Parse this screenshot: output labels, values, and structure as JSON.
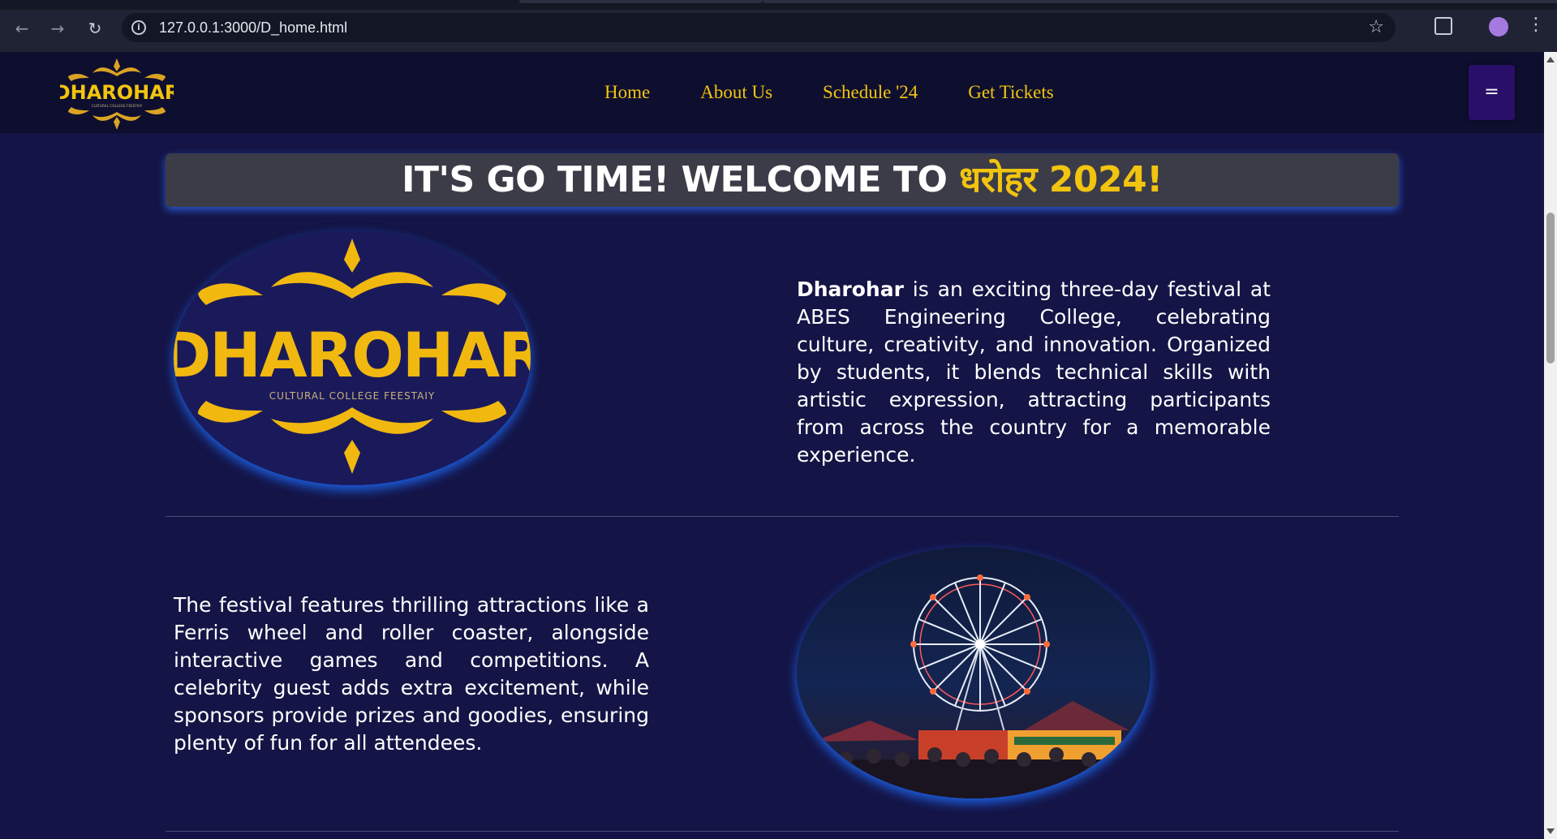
{
  "browser": {
    "url": "127.0.0.1:3000/D_home.html",
    "back_icon": "arrow-left-icon",
    "forward_icon": "arrow-right-icon",
    "reload_icon": "reload-icon",
    "info_icon": "site-info-icon",
    "bookmark_icon": "star-icon",
    "extensions_icon": "puzzle-icon",
    "menu_icon": "vertical-dots-icon"
  },
  "header": {
    "logo_text": "DHAROHAR",
    "logo_subtext": "CULTURAL COLLEGE FEESTAIY",
    "nav": [
      {
        "label": "Home"
      },
      {
        "label": "About Us"
      },
      {
        "label": "Schedule '24"
      },
      {
        "label": "Get Tickets"
      }
    ],
    "menu_button": "="
  },
  "banner": {
    "prefix": "IT'S GO TIME! WELCOME TO ",
    "accent": "धरोहर 2024!"
  },
  "section1": {
    "logo_title": "DHAROHAR",
    "logo_subtitle": "CULTURAL COLLEGE FEESTAIY",
    "bold": "Dharohar",
    "text": " is an exciting three-day festival at ABES Engineering College, celebrating culture, creativity, and innovation. Organized by students, it blends technical skills with artistic expression, attracting participants from across the country for a memorable experience."
  },
  "section2": {
    "text": "The festival features thrilling attractions like a Ferris wheel and roller coaster, alongside interactive games and competitions. A celebrity guest adds extra excitement, while sponsors provide prizes and goodies, ensuring plenty of fun for all attendees."
  },
  "colors": {
    "background": "#141446",
    "header": "#0e0e2f",
    "accent": "#f1c40f",
    "banner": "#3c3c48",
    "menu_button": "#2a0f68"
  }
}
